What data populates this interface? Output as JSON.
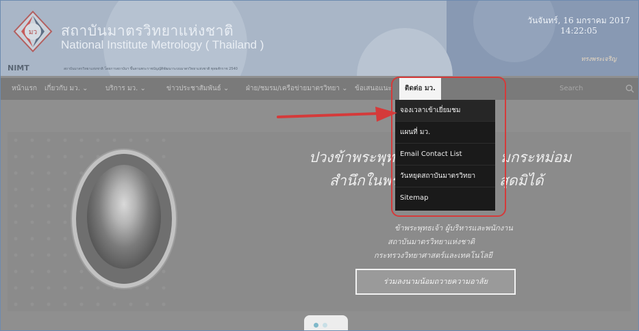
{
  "header": {
    "logo_text": "มว",
    "abbreviation": "NIMT",
    "title_th": "สถาบันมาตรวิทยาแห่งชาติ",
    "title_en": "National Institute Metrology ( Thailand )",
    "tagline": "สถาบันมาตรวิทยาแห่งชาติ โดยการสถาบันฯ ขึ้นตามพระราชบัญญัติพัฒนาระบบมาตรวิทยาแห่งชาติ พุทธศักราช 2540",
    "date": "วันจันทร์, 16 มกราคม 2017",
    "time": "14:22:05",
    "signature": "ทรงพระเจริญ"
  },
  "nav": {
    "items": [
      {
        "label": "หน้าแรก"
      },
      {
        "label": "เกี่ยวกับ มว. ⌄"
      },
      {
        "label": "บริการ มว. ⌄"
      },
      {
        "label": "ข่าวประชาสัมพันธ์ ⌄"
      },
      {
        "label": "ฝ่าย/ชมรม/เครือข่ายมาตรวิทยา ⌄"
      },
      {
        "label": "ข้อเสนอแนะ"
      },
      {
        "label": "ติดต่อ มว."
      }
    ],
    "search_placeholder": "Search"
  },
  "dropdown": {
    "items": [
      {
        "label": "จองเวลาเข้าเยี่ยมชม"
      },
      {
        "label": "แผนที่ มว."
      },
      {
        "label": "Email Contact List"
      },
      {
        "label": "วันหยุดสถาบันมาตรวิทยา"
      },
      {
        "label": "Sitemap"
      }
    ]
  },
  "banner": {
    "line1a": "ปวงข้าพระพุทธเจ้า",
    "line1b": "มกระหม่อม",
    "line2a": "สำนึกในพระม",
    "line2b": "สุดมิได้",
    "sub1": "ข้าพระพุทธเจ้า ผู้บริหารและพนักงาน",
    "sub2": "สถาบันมาตรวิทยาแห่งชาติ",
    "sub3": "กระทรวงวิทยาศาสตร์และเทคโนโลยี",
    "button": "ร่วมลงนามน้อมถวายความอาลัย"
  },
  "colors": {
    "nav_bg": "#7a7a7a",
    "dropdown_bg": "#1a1a1a",
    "annotation_red": "#d53a3a"
  }
}
